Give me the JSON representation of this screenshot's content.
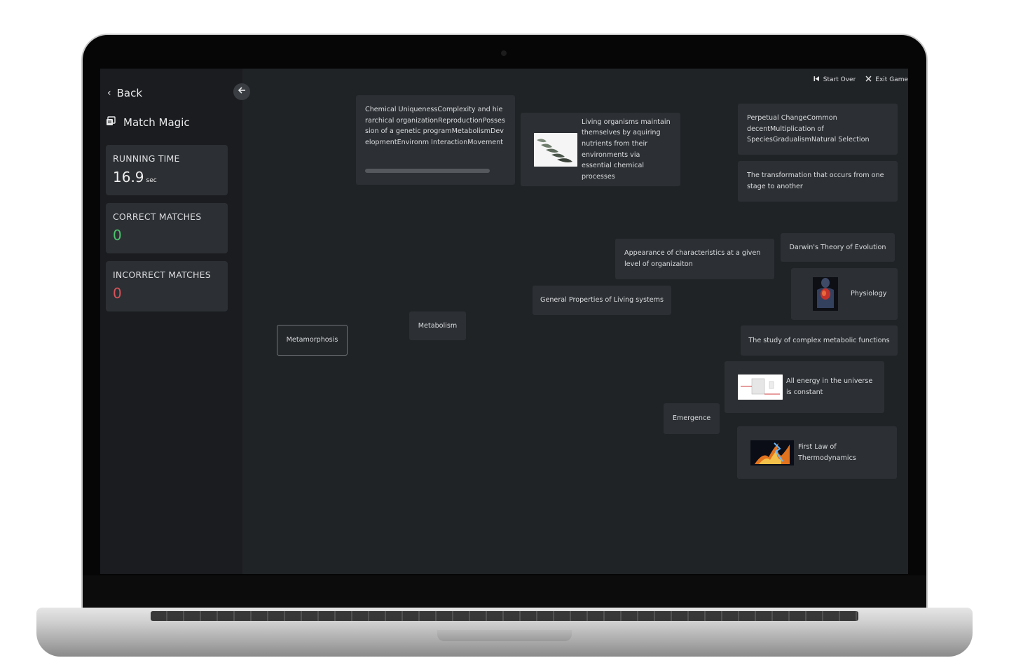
{
  "sidebar": {
    "back_label": "Back",
    "app_title": "Match Magic",
    "stats": {
      "running_time": {
        "label": "RUNNING TIME",
        "value": "16.9",
        "unit": "sec"
      },
      "correct": {
        "label": "CORRECT MATCHES",
        "value": "0",
        "color": "#4cc46e"
      },
      "incorrect": {
        "label": "INCORRECT MATCHES",
        "value": "0",
        "color": "#d9535b"
      }
    }
  },
  "toolbar": {
    "start_over": "Start Over",
    "exit_game": "Exit Game"
  },
  "cards": {
    "chemical": "Chemical UniquenessComplexity and hierarchical organizationReproductionPossession of a genetic programMetabolismDevelopmentEnvironm InteractionMovement",
    "living_organisms": "Living organisms maintain themselves by aquiring nutrients from their environments via essential chemical processes",
    "perpetual_change": "Perpetual ChangeCommon decentMultiplication of SpeciesGradualismNatural Selection",
    "transformation": "The transformation that occurs from one stage to another",
    "darwin": "Darwin's Theory of Evolution",
    "appearance": "Appearance of characteristics at a given level of organizaiton",
    "physiology": "Physiology",
    "general_properties": "General Properties of Living systems",
    "metabolism": "Metabolism",
    "metamorphosis": "Metamorphosis",
    "study_metabolic": "The study of complex metabolic functions",
    "all_energy": "All energy in the universe is constant",
    "emergence": "Emergence",
    "first_law": "First Law of Thermodynamics"
  },
  "icons": {
    "back": "chevron-left-icon",
    "app": "layers-icon",
    "collapse": "arrow-left-icon",
    "start_over": "skip-back-icon",
    "exit": "close-icon"
  },
  "colors": {
    "background": "#202326",
    "sidebar": "#1a1c1f",
    "card": "#2c2f33",
    "correct": "#4cc46e",
    "incorrect": "#d9535b"
  }
}
